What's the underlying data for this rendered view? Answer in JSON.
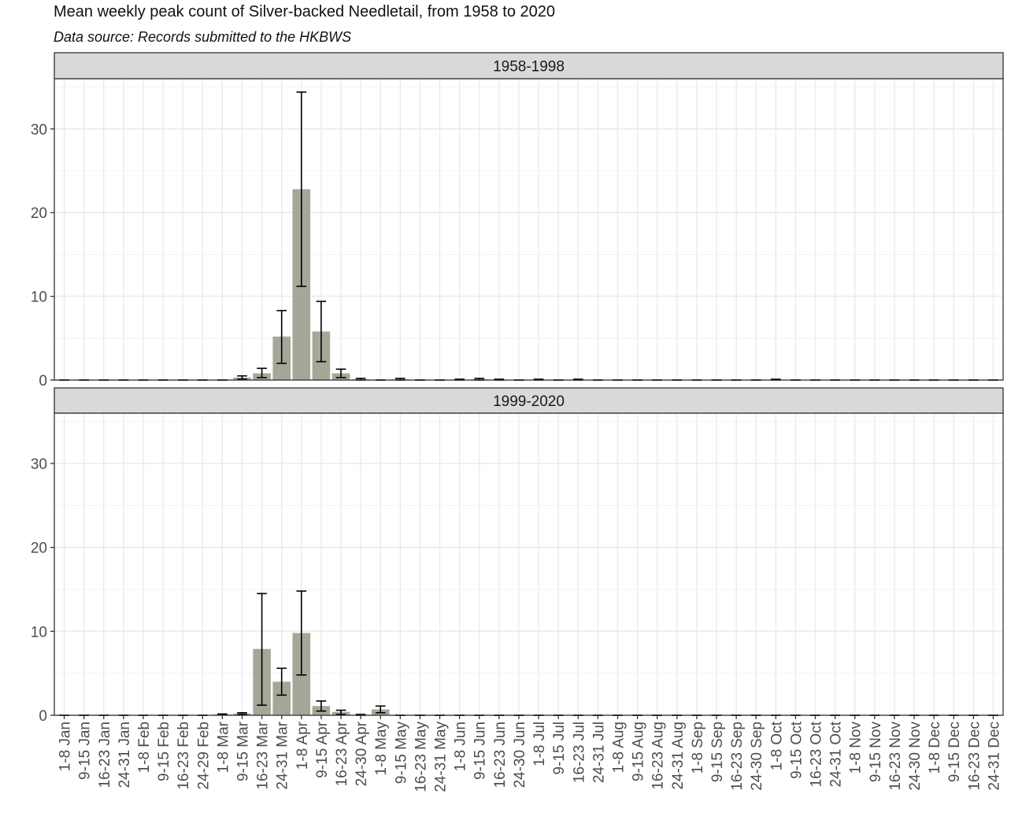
{
  "title": "Mean weekly peak count of Silver-backed Needletail, from 1958 to 2020",
  "subtitle": "Data source: Records submitted to the HKBWS",
  "colors": {
    "bar": "#a5a899",
    "strip": "#d9d9d9",
    "grid": "#ebebeb",
    "errorbar": "#000000"
  },
  "chart_data": {
    "type": "bar",
    "facet_layout": "vertical",
    "grid": true,
    "error_bars": true,
    "ylim": [
      0,
      36
    ],
    "yticks": [
      0,
      10,
      20,
      30
    ],
    "categories": [
      "1-8 Jan",
      "9-15 Jan",
      "16-23 Jan",
      "24-31 Jan",
      "1-8 Feb",
      "9-15 Feb",
      "16-23 Feb",
      "24-29 Feb",
      "1-8 Mar",
      "9-15 Mar",
      "16-23 Mar",
      "24-31 Mar",
      "1-8 Apr",
      "9-15 Apr",
      "16-23 Apr",
      "24-30 Apr",
      "1-8 May",
      "9-15 May",
      "16-23 May",
      "24-31 May",
      "1-8 Jun",
      "9-15 Jun",
      "16-23 Jun",
      "24-30 Jun",
      "1-8 Jul",
      "9-15 Jul",
      "16-23 Jul",
      "24-31 Jul",
      "1-8 Aug",
      "9-15 Aug",
      "16-23 Aug",
      "24-31 Aug",
      "1-8 Sep",
      "9-15 Sep",
      "16-23 Sep",
      "24-30 Sep",
      "1-8 Oct",
      "9-15 Oct",
      "16-23 Oct",
      "24-31 Oct",
      "1-8 Nov",
      "9-15 Nov",
      "16-23 Nov",
      "24-30 Nov",
      "1-8 Dec",
      "9-15 Dec",
      "16-23 Dec",
      "24-31 Dec"
    ],
    "panels": [
      {
        "strip": "1958-1998",
        "values": [
          0,
          0,
          0,
          0,
          0,
          0,
          0,
          0,
          0,
          0.3,
          0.8,
          5.2,
          22.8,
          5.8,
          0.8,
          0.1,
          0,
          0.1,
          0,
          0,
          0.05,
          0.1,
          0.05,
          0,
          0.05,
          0,
          0.05,
          0,
          0,
          0,
          0,
          0,
          0,
          0,
          0,
          0,
          0.05,
          0,
          0,
          0,
          0,
          0,
          0,
          0,
          0,
          0,
          0,
          0
        ],
        "err_low": [
          0,
          0,
          0,
          0,
          0,
          0,
          0,
          0,
          0,
          0.1,
          0.3,
          2.0,
          11.2,
          2.2,
          0.3,
          0.0,
          0,
          0.0,
          0,
          0,
          0,
          0,
          0,
          0,
          0,
          0,
          0,
          0,
          0,
          0,
          0,
          0,
          0,
          0,
          0,
          0,
          0,
          0,
          0,
          0,
          0,
          0,
          0,
          0,
          0,
          0,
          0,
          0
        ],
        "err_high": [
          0,
          0,
          0,
          0,
          0,
          0,
          0,
          0,
          0,
          0.5,
          1.4,
          8.3,
          34.4,
          9.4,
          1.3,
          0.2,
          0,
          0.2,
          0,
          0,
          0.1,
          0.2,
          0.1,
          0,
          0.1,
          0,
          0.1,
          0,
          0,
          0,
          0,
          0,
          0,
          0,
          0,
          0,
          0.1,
          0,
          0,
          0,
          0,
          0,
          0,
          0,
          0,
          0,
          0,
          0
        ]
      },
      {
        "strip": "1999-2020",
        "values": [
          0,
          0,
          0,
          0,
          0,
          0,
          0,
          0,
          0.1,
          0.2,
          7.9,
          4.0,
          9.8,
          1.1,
          0.4,
          0.05,
          0.7,
          0,
          0,
          0,
          0,
          0,
          0,
          0,
          0,
          0,
          0,
          0,
          0,
          0,
          0,
          0,
          0,
          0,
          0,
          0,
          0,
          0,
          0,
          0,
          0,
          0,
          0,
          0,
          0,
          0,
          0,
          0
        ],
        "err_low": [
          0,
          0,
          0,
          0,
          0,
          0,
          0,
          0,
          0.05,
          0.1,
          1.2,
          2.4,
          4.8,
          0.5,
          0.1,
          0,
          0.3,
          0,
          0,
          0,
          0,
          0,
          0,
          0,
          0,
          0,
          0,
          0,
          0,
          0,
          0,
          0,
          0,
          0,
          0,
          0,
          0,
          0,
          0,
          0,
          0,
          0,
          0,
          0,
          0,
          0,
          0,
          0
        ],
        "err_high": [
          0,
          0,
          0,
          0,
          0,
          0,
          0,
          0,
          0.15,
          0.3,
          14.5,
          5.6,
          14.8,
          1.7,
          0.6,
          0.1,
          1.1,
          0,
          0,
          0,
          0,
          0,
          0,
          0,
          0,
          0,
          0,
          0,
          0,
          0,
          0,
          0,
          0,
          0,
          0,
          0,
          0,
          0,
          0,
          0,
          0,
          0,
          0,
          0,
          0,
          0,
          0,
          0
        ]
      }
    ]
  }
}
